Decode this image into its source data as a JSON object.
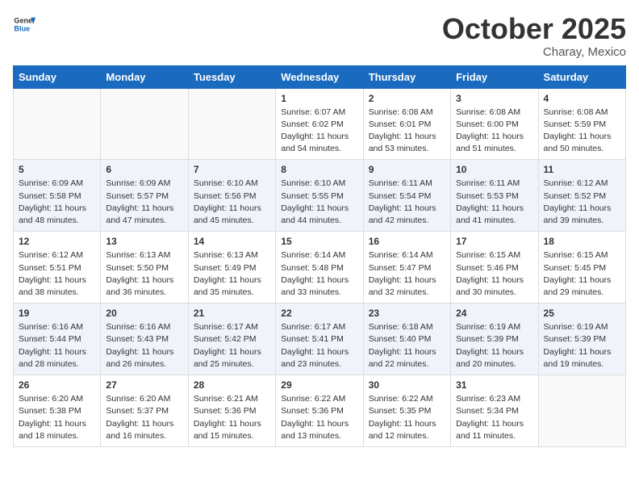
{
  "logo": {
    "general": "General",
    "blue": "Blue"
  },
  "title": "October 2025",
  "location": "Charay, Mexico",
  "days_of_week": [
    "Sunday",
    "Monday",
    "Tuesday",
    "Wednesday",
    "Thursday",
    "Friday",
    "Saturday"
  ],
  "weeks": [
    [
      {
        "day": "",
        "info": ""
      },
      {
        "day": "",
        "info": ""
      },
      {
        "day": "",
        "info": ""
      },
      {
        "day": "1",
        "info": "Sunrise: 6:07 AM\nSunset: 6:02 PM\nDaylight: 11 hours and 54 minutes."
      },
      {
        "day": "2",
        "info": "Sunrise: 6:08 AM\nSunset: 6:01 PM\nDaylight: 11 hours and 53 minutes."
      },
      {
        "day": "3",
        "info": "Sunrise: 6:08 AM\nSunset: 6:00 PM\nDaylight: 11 hours and 51 minutes."
      },
      {
        "day": "4",
        "info": "Sunrise: 6:08 AM\nSunset: 5:59 PM\nDaylight: 11 hours and 50 minutes."
      }
    ],
    [
      {
        "day": "5",
        "info": "Sunrise: 6:09 AM\nSunset: 5:58 PM\nDaylight: 11 hours and 48 minutes."
      },
      {
        "day": "6",
        "info": "Sunrise: 6:09 AM\nSunset: 5:57 PM\nDaylight: 11 hours and 47 minutes."
      },
      {
        "day": "7",
        "info": "Sunrise: 6:10 AM\nSunset: 5:56 PM\nDaylight: 11 hours and 45 minutes."
      },
      {
        "day": "8",
        "info": "Sunrise: 6:10 AM\nSunset: 5:55 PM\nDaylight: 11 hours and 44 minutes."
      },
      {
        "day": "9",
        "info": "Sunrise: 6:11 AM\nSunset: 5:54 PM\nDaylight: 11 hours and 42 minutes."
      },
      {
        "day": "10",
        "info": "Sunrise: 6:11 AM\nSunset: 5:53 PM\nDaylight: 11 hours and 41 minutes."
      },
      {
        "day": "11",
        "info": "Sunrise: 6:12 AM\nSunset: 5:52 PM\nDaylight: 11 hours and 39 minutes."
      }
    ],
    [
      {
        "day": "12",
        "info": "Sunrise: 6:12 AM\nSunset: 5:51 PM\nDaylight: 11 hours and 38 minutes."
      },
      {
        "day": "13",
        "info": "Sunrise: 6:13 AM\nSunset: 5:50 PM\nDaylight: 11 hours and 36 minutes."
      },
      {
        "day": "14",
        "info": "Sunrise: 6:13 AM\nSunset: 5:49 PM\nDaylight: 11 hours and 35 minutes."
      },
      {
        "day": "15",
        "info": "Sunrise: 6:14 AM\nSunset: 5:48 PM\nDaylight: 11 hours and 33 minutes."
      },
      {
        "day": "16",
        "info": "Sunrise: 6:14 AM\nSunset: 5:47 PM\nDaylight: 11 hours and 32 minutes."
      },
      {
        "day": "17",
        "info": "Sunrise: 6:15 AM\nSunset: 5:46 PM\nDaylight: 11 hours and 30 minutes."
      },
      {
        "day": "18",
        "info": "Sunrise: 6:15 AM\nSunset: 5:45 PM\nDaylight: 11 hours and 29 minutes."
      }
    ],
    [
      {
        "day": "19",
        "info": "Sunrise: 6:16 AM\nSunset: 5:44 PM\nDaylight: 11 hours and 28 minutes."
      },
      {
        "day": "20",
        "info": "Sunrise: 6:16 AM\nSunset: 5:43 PM\nDaylight: 11 hours and 26 minutes."
      },
      {
        "day": "21",
        "info": "Sunrise: 6:17 AM\nSunset: 5:42 PM\nDaylight: 11 hours and 25 minutes."
      },
      {
        "day": "22",
        "info": "Sunrise: 6:17 AM\nSunset: 5:41 PM\nDaylight: 11 hours and 23 minutes."
      },
      {
        "day": "23",
        "info": "Sunrise: 6:18 AM\nSunset: 5:40 PM\nDaylight: 11 hours and 22 minutes."
      },
      {
        "day": "24",
        "info": "Sunrise: 6:19 AM\nSunset: 5:39 PM\nDaylight: 11 hours and 20 minutes."
      },
      {
        "day": "25",
        "info": "Sunrise: 6:19 AM\nSunset: 5:39 PM\nDaylight: 11 hours and 19 minutes."
      }
    ],
    [
      {
        "day": "26",
        "info": "Sunrise: 6:20 AM\nSunset: 5:38 PM\nDaylight: 11 hours and 18 minutes."
      },
      {
        "day": "27",
        "info": "Sunrise: 6:20 AM\nSunset: 5:37 PM\nDaylight: 11 hours and 16 minutes."
      },
      {
        "day": "28",
        "info": "Sunrise: 6:21 AM\nSunset: 5:36 PM\nDaylight: 11 hours and 15 minutes."
      },
      {
        "day": "29",
        "info": "Sunrise: 6:22 AM\nSunset: 5:36 PM\nDaylight: 11 hours and 13 minutes."
      },
      {
        "day": "30",
        "info": "Sunrise: 6:22 AM\nSunset: 5:35 PM\nDaylight: 11 hours and 12 minutes."
      },
      {
        "day": "31",
        "info": "Sunrise: 6:23 AM\nSunset: 5:34 PM\nDaylight: 11 hours and 11 minutes."
      },
      {
        "day": "",
        "info": ""
      }
    ]
  ]
}
